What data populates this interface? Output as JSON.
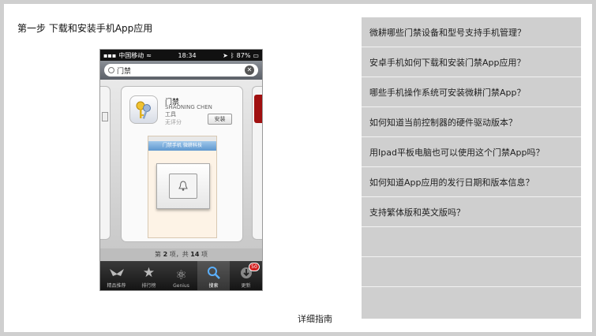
{
  "step": {
    "title": "第一步 下载和安装手机App应用"
  },
  "phone": {
    "status": {
      "carrier": "中国移动",
      "time": "18:34",
      "battery": "87%"
    },
    "search": {
      "query": "门禁"
    },
    "app": {
      "name": "门禁",
      "developer": "SHAONING CHEN",
      "category": "工具",
      "rating": "无评分",
      "install_label": "安装",
      "screenshot_nav": "门禁手机 微耕科技"
    },
    "pagination": {
      "prefix": "第",
      "page": "2",
      "middle": "项，共",
      "total": "14",
      "suffix": "项"
    },
    "tabs": [
      {
        "label": "精品推荐",
        "icon": "featured-icon"
      },
      {
        "label": "排行榜",
        "icon": "star-icon"
      },
      {
        "label": "Genius",
        "icon": "genius-icon"
      },
      {
        "label": "搜索",
        "icon": "search-icon"
      },
      {
        "label": "更新",
        "icon": "update-icon",
        "badge": "50"
      }
    ]
  },
  "detail_link": "详细指南",
  "faq": {
    "items": [
      "微耕哪些门禁设备和型号支持手机管理？",
      "安卓手机如何下载和安装门禁App应用？",
      "哪些手机操作系统可安装微耕门禁App？",
      "如何知道当前控制器的硬件驱动版本？",
      "用Ipad平板电脑也可以使用这个门禁App吗？",
      "如何知道App应用的发行日期和版本信息？",
      "支持繁体版和英文版吗？"
    ]
  },
  "colors": {
    "frame": "#cfcfcf",
    "faq_bg": "#cfcfcf",
    "badge": "#d21f1f",
    "nav_blue": "#5e97cf"
  }
}
